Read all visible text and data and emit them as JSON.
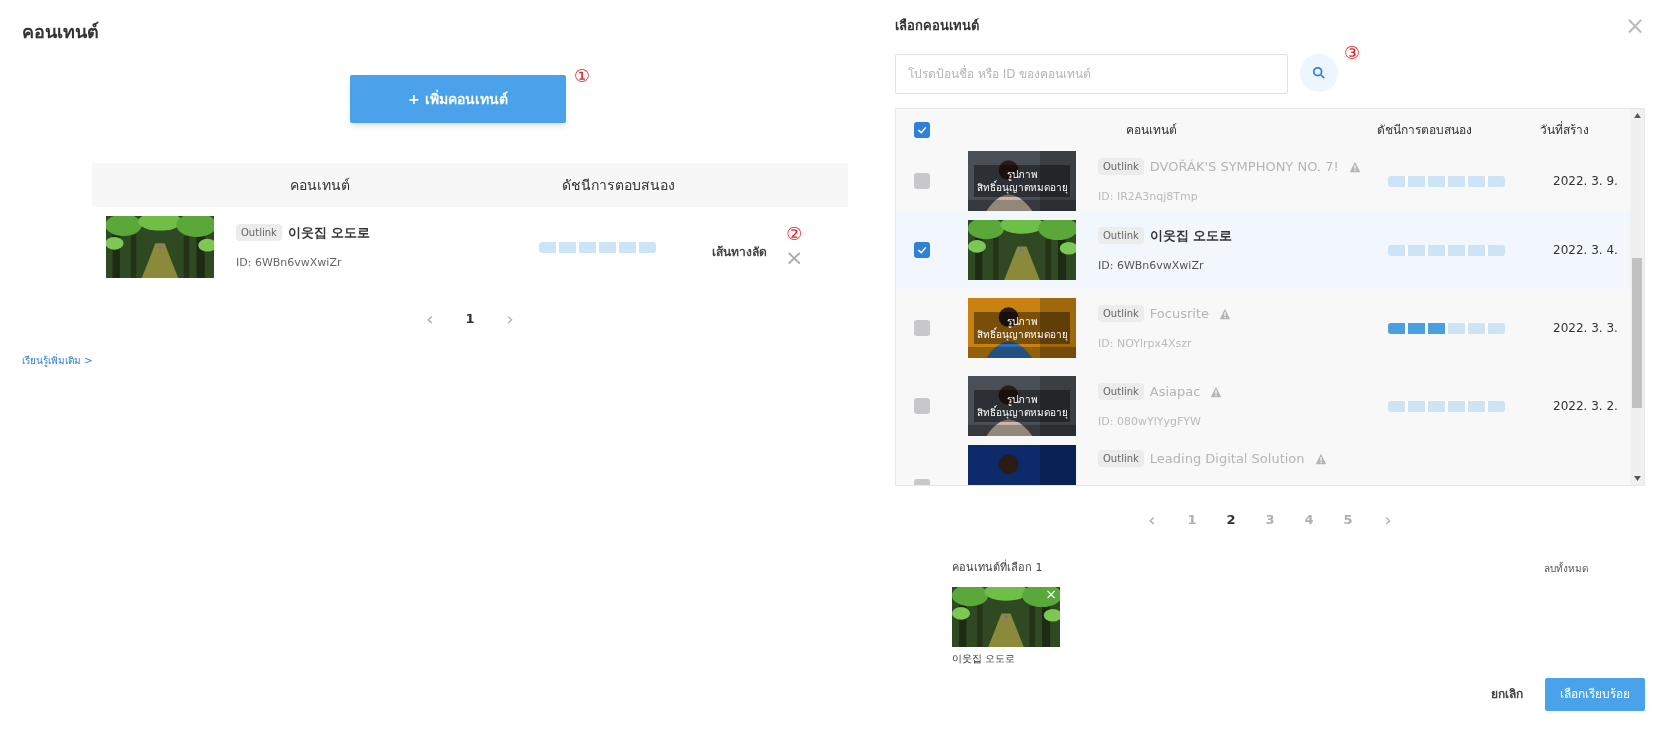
{
  "page": {
    "title": "คอนเทนต์",
    "add_button": "+ เพิ่มคอนเทนต์",
    "learn_more": "เรียนรู้เพิ่มเติม >"
  },
  "annotations": [
    "①",
    "②",
    "③"
  ],
  "content_table": {
    "columns": [
      "คอนเทนต์",
      "ดัชนีการตอบสนอง"
    ],
    "rows": [
      {
        "badge": "Outlink",
        "title": "이웃집 오도로",
        "id": "ID: 6WBn6vwXwiZr",
        "action": "เส้นทางลัด",
        "remove": "×"
      }
    ]
  },
  "content_pagination": {
    "prev": "‹",
    "pages": [
      {
        "label": "1",
        "selected": true
      }
    ],
    "next": "›"
  },
  "dialog": {
    "title": "เลือกคอนเทนต์",
    "close": "×",
    "search": {
      "placeholder": "โปรดป้อนชื่อ หรือ ID ของคอนเทนต์"
    },
    "table": {
      "all_checked": true,
      "columns": [
        "คอนเทนต์",
        "ดัชนีการตอบสนอง",
        "วันที่สร้าง"
      ],
      "rows": [
        {
          "kind": "full",
          "checked": false,
          "disabled": true,
          "overlay": [
            "รูปภาพ",
            "สิทธิ์อนุญาตหมดอายุ"
          ],
          "badge": "Outlink",
          "title": "DVOŘÁK'S SYMPHONY NO. 7!",
          "id": "ID: IR2A3nqj8Tmp",
          "date": "2022. 3. 9."
        },
        {
          "kind": "full",
          "checked": true,
          "disabled": false,
          "badge": "Outlink",
          "title": "이웃집 오도로",
          "id": "ID: 6WBn6vwXwiZr",
          "date": "2022. 3. 4."
        },
        {
          "kind": "full",
          "checked": false,
          "disabled": true,
          "overlay": [
            "รูปภาพ",
            "สิทธิ์อนุญาตหมดอายุ"
          ],
          "badge": "Outlink",
          "title": "Focusrite",
          "id": "ID: NOYlrpx4Xszr",
          "level": 0.5,
          "date": "2022. 3. 3."
        },
        {
          "kind": "full",
          "checked": false,
          "disabled": true,
          "overlay": [
            "รูปภาพ",
            "สิทธิ์อนุญาตหมดอายุ"
          ],
          "badge": "Outlink",
          "title": "Asiapac",
          "id": "ID: 080wYlYygFYW",
          "date": "2022. 3. 2."
        },
        {
          "kind": "partial",
          "checked": false,
          "disabled": true,
          "badge": "Outlink",
          "title": "Leading Digital Solution"
        }
      ]
    },
    "pagination": {
      "prev": "‹",
      "pages": [
        {
          "label": "1",
          "selected": false
        },
        {
          "label": "2",
          "selected": true
        },
        {
          "label": "3",
          "selected": false
        },
        {
          "label": "4",
          "selected": false
        },
        {
          "label": "5",
          "selected": false
        }
      ],
      "next": "›"
    },
    "selected": {
      "label": "คอนเทนต์ที่เลือก 1",
      "clear_all": "ลบทั้งหมด",
      "items": [
        {
          "title": "이웃집 오도로",
          "remove": "×"
        }
      ]
    },
    "buttons": {
      "cancel": "ยกเลิก",
      "confirm": "เลือกเรียบร้อย"
    }
  }
}
